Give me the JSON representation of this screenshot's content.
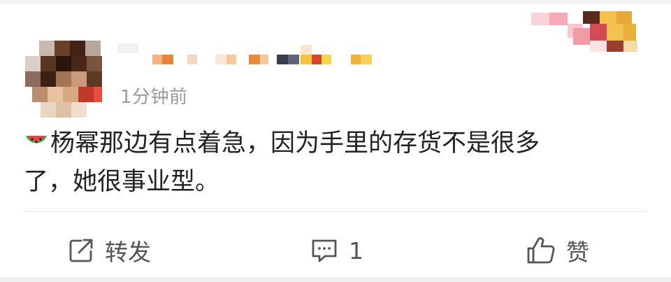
{
  "post": {
    "time": "1分钟前",
    "text_line1": "杨幂那边有点着急，因为手里的存货不是很多",
    "text_line2": "了，她很事业型。"
  },
  "actions": {
    "repost_label": "转发",
    "comment_count": "1",
    "like_label": "赞"
  },
  "icons": {
    "content_emoji": "watermelon-icon",
    "repost": "share-out-icon",
    "comment": "comment-icon",
    "like": "thumbs-up-icon"
  }
}
